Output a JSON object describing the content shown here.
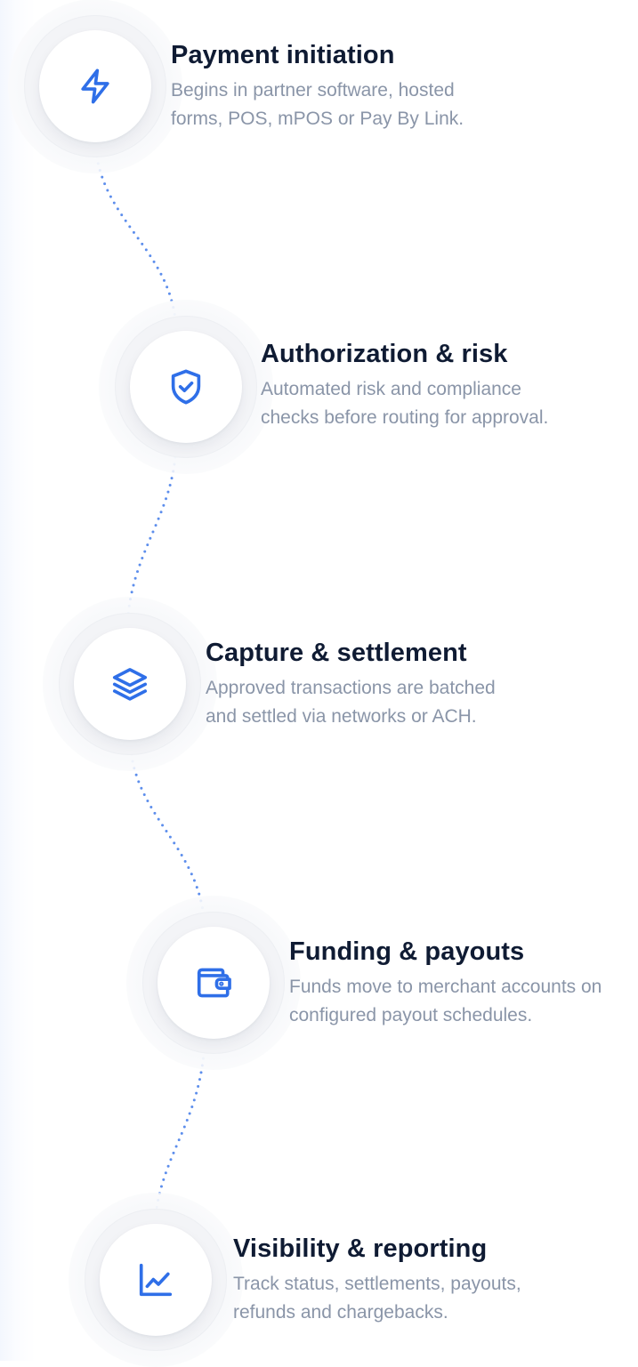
{
  "accent_color": "#2f6fe8",
  "steps": [
    {
      "icon": "lightning-bolt-icon",
      "title": "Payment initiation",
      "desc_line1": "Begins in partner software, hosted",
      "desc_line2": "forms, POS, mPOS or Pay By Link."
    },
    {
      "icon": "shield-check-icon",
      "title": "Authorization & risk",
      "desc_line1": "Automated risk and compliance",
      "desc_line2": "checks before routing for approval."
    },
    {
      "icon": "layers-icon",
      "title": "Capture & settlement",
      "desc_line1": "Approved transactions are batched",
      "desc_line2": "and settled via networks or ACH."
    },
    {
      "icon": "wallet-icon",
      "title": "Funding & payouts",
      "desc_line1": "Funds move to merchant accounts on",
      "desc_line2": "configured payout schedules."
    },
    {
      "icon": "chart-line-icon",
      "title": "Visibility & reporting",
      "desc_line1": "Track status, settlements, payouts,",
      "desc_line2": "refunds and chargebacks."
    }
  ]
}
